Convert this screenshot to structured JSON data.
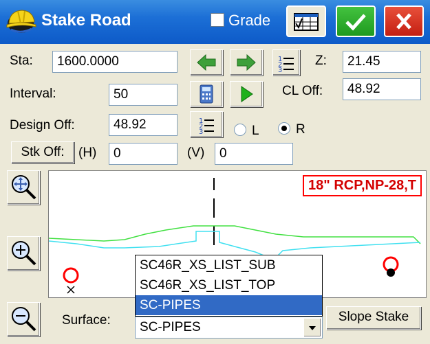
{
  "window": {
    "title": "Stake Road"
  },
  "header": {
    "grade_label": "Grade",
    "grade_checked": false
  },
  "fields": {
    "sta_label": "Sta:",
    "sta_value": "1600.0000",
    "z_label": "Z:",
    "z_value": "21.45",
    "interval_label": "Interval:",
    "interval_value": "50",
    "cl_off_label": "CL Off:",
    "cl_off_value": "48.92",
    "design_off_label": "Design Off:",
    "design_off_value": "48.92",
    "side_left_label": "L",
    "side_right_label": "R",
    "side_selected": "R",
    "stk_off_label": "Stk Off:",
    "h_label": "(H)",
    "h_value": "0",
    "v_label": "(V)",
    "v_value": "0"
  },
  "graphic": {
    "pipe_label": "18\" RCP,NP-28,T"
  },
  "bottom": {
    "surface_label": "Surface:",
    "surface_options": [
      "SC46R_XS_LIST_SUB",
      "SC46R_XS_LIST_TOP",
      "SC-PIPES"
    ],
    "surface_selected": "SC-PIPES",
    "slope_stake_label": "Slope Stake"
  },
  "colors": {
    "titlebar": "#0d5ac8",
    "ok": "#1f9a1f",
    "cancel": "#c41f12",
    "pipe_label": "#ff0000",
    "selection": "#316ac5"
  }
}
